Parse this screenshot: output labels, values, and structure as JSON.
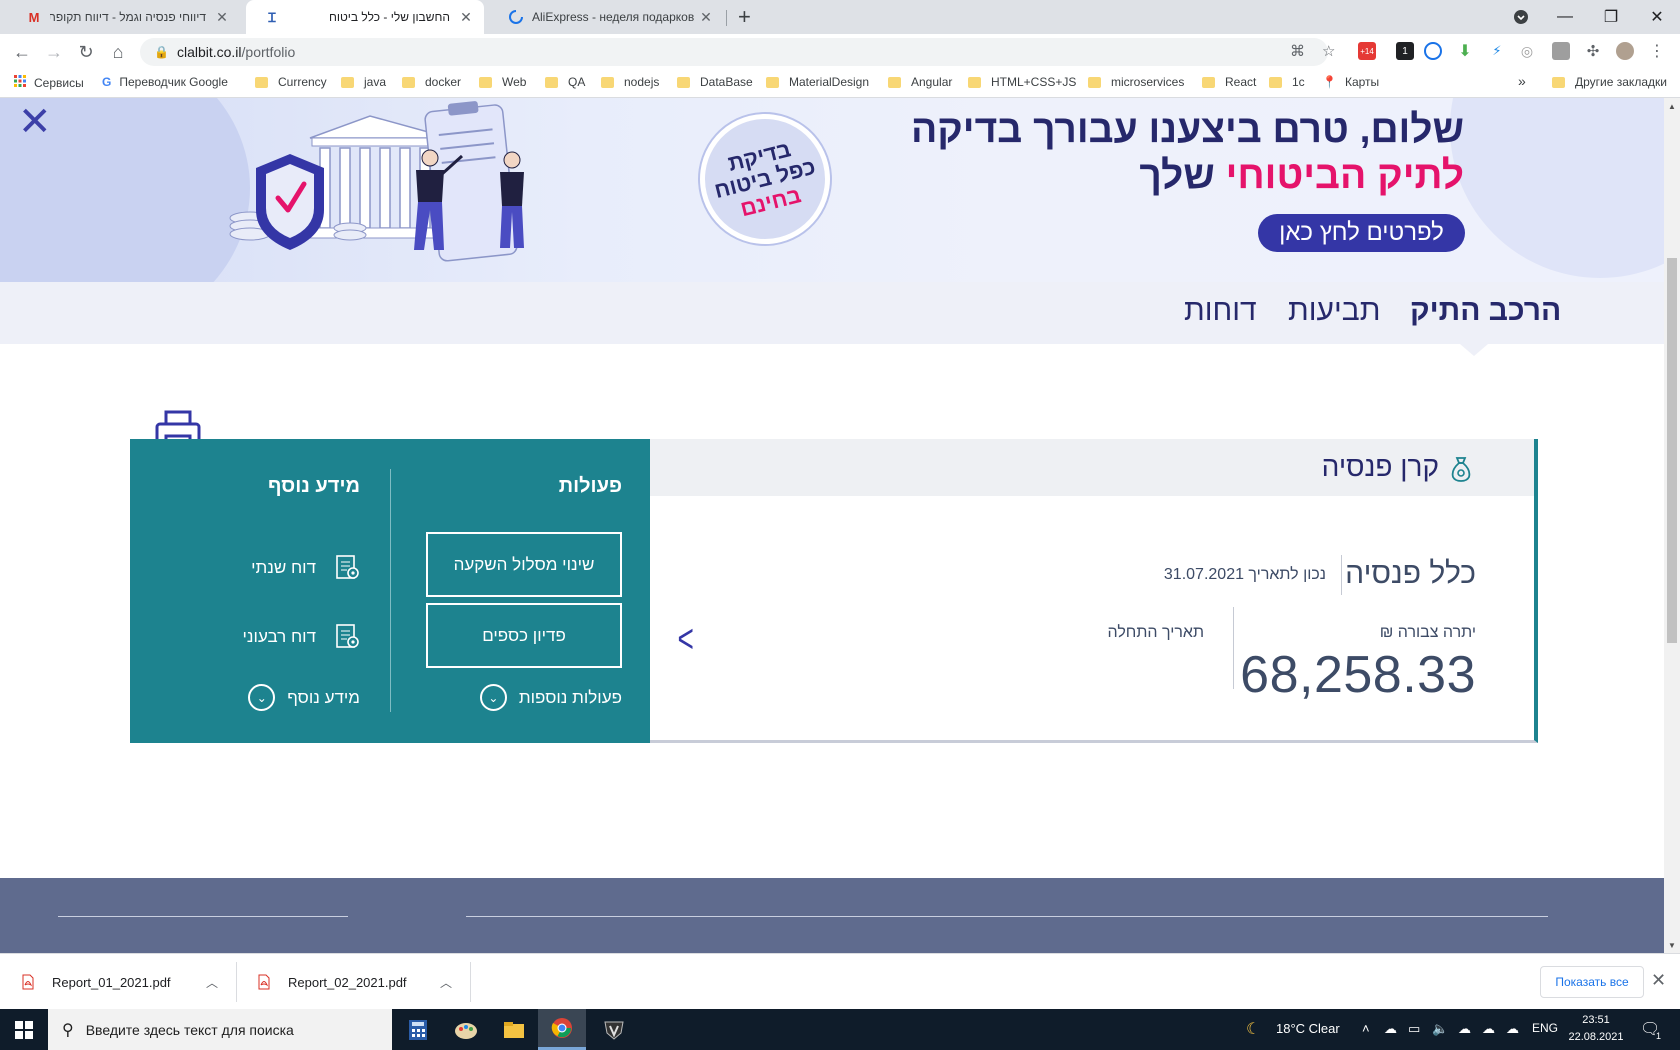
{
  "browser": {
    "tabs": [
      {
        "title": "דיווחי פנסיה וגמל - דיווח תקופתי",
        "favicon": "gmail-icon",
        "active": false
      },
      {
        "title": "החשבון שלי - כלל ביטוח",
        "favicon": "clal-icon",
        "active": true
      },
      {
        "title": "AliExpress - неделя подарков",
        "favicon": "loading-icon",
        "active": false
      }
    ],
    "url_host": "clalbit.co.il",
    "url_path": "/portfolio",
    "extension_badges": [
      "+14",
      "1"
    ],
    "bookmarks": [
      {
        "label": "Сервисы",
        "icon": "apps-icon"
      },
      {
        "label": "Переводчик Google",
        "icon": "translate-icon"
      },
      {
        "label": "Currency",
        "icon": "folder-icon"
      },
      {
        "label": "java",
        "icon": "folder-icon"
      },
      {
        "label": "docker",
        "icon": "folder-icon"
      },
      {
        "label": "Web",
        "icon": "folder-icon"
      },
      {
        "label": "QA",
        "icon": "folder-icon"
      },
      {
        "label": "nodejs",
        "icon": "folder-icon"
      },
      {
        "label": "DataBase",
        "icon": "folder-icon"
      },
      {
        "label": "MaterialDesign",
        "icon": "folder-icon"
      },
      {
        "label": "Angular",
        "icon": "folder-icon"
      },
      {
        "label": "HTML+CSS+JS",
        "icon": "folder-icon"
      },
      {
        "label": "microservices",
        "icon": "folder-icon"
      },
      {
        "label": "React",
        "icon": "folder-icon"
      },
      {
        "label": "1c",
        "icon": "folder-icon"
      },
      {
        "label": "Карты",
        "icon": "maps-icon"
      }
    ],
    "more_bookmarks_chevron": "»",
    "other_bookmarks": "Другие закладки"
  },
  "banner": {
    "line1": "שלום, טרם ביצענו עבורך בדיקה",
    "line2_highlight": "לתיק הביטוחי",
    "line2_rest": "שלך",
    "cta": "לפרטים לחץ כאן",
    "seal_line1": "בדיקת",
    "seal_line2": "כפל ביטוח",
    "seal_line3": "בחינם",
    "colors": {
      "navy": "#26286b",
      "pink": "#e5136b",
      "button": "#3436a6"
    }
  },
  "subnav": {
    "items": [
      "הרכב התיק",
      "תביעות",
      "דוחות"
    ],
    "active_index": 0
  },
  "actions": {
    "heading": "פעולות",
    "buttons": [
      "שינוי מסלול השקעה",
      "פדיון כספים"
    ],
    "more": "פעולות נוספות"
  },
  "info": {
    "heading": "מידע נוסף",
    "links": [
      "דוח שנתי",
      "דוח רבעוני"
    ],
    "more": "מידע נוסף"
  },
  "fund": {
    "product_title": "קרן פנסיה",
    "fund_name": "כלל פנסיה",
    "as_of": "נכון לתאריך 31.07.2021",
    "balance_label": "יתרה צבורה ₪",
    "balance_value": "68,258.33",
    "start_date_label": "תאריך התחלה",
    "colors": {
      "teal": "#1d838f",
      "text": "#3d4b66"
    }
  },
  "downloads": {
    "files": [
      "Report_01_2021.pdf",
      "Report_02_2021.pdf"
    ],
    "show_all": "Показать все"
  },
  "taskbar": {
    "search_placeholder": "Введите здесь текст для поиска",
    "weather": "18°C  Clear",
    "lang": "ENG",
    "time": "23:51",
    "date": "22.08.2021",
    "notifications": "1"
  }
}
